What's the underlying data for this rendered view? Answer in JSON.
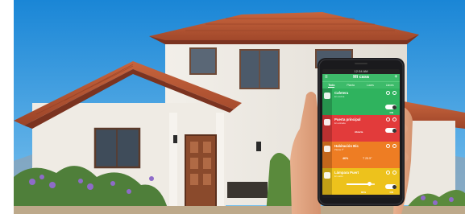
{
  "app": {
    "status_time": "12:34 AM",
    "title": "Mi casa",
    "tabs": [
      "Todo",
      "Planta",
      "Luces",
      "Llaves"
    ],
    "active_tab_index": 0
  },
  "devices": [
    {
      "name": "Cafetera",
      "subtitle": "En cocina",
      "state": "ON",
      "color": "#2fb35e",
      "icon": "coffee-maker-icon",
      "toggle_on": true
    },
    {
      "name": "Puerta principal",
      "subtitle": "En entrada",
      "state": "Abierta",
      "color": "#e23b3b",
      "icon": "door-lock-icon",
      "toggle_on": true
    },
    {
      "name": "Habitación Bic",
      "subtitle": "Planta 1ª",
      "humidity": "46%",
      "temperature": "T 25.5°",
      "color": "#ee7d23",
      "icon": "thermostat-icon"
    },
    {
      "name": "Lámpara Puert",
      "subtitle": "En salón",
      "level": "80%",
      "level_fraction": 0.8,
      "state": "ON",
      "color": "#edc21c",
      "icon": "lamp-icon",
      "toggle_on": true
    }
  ]
}
